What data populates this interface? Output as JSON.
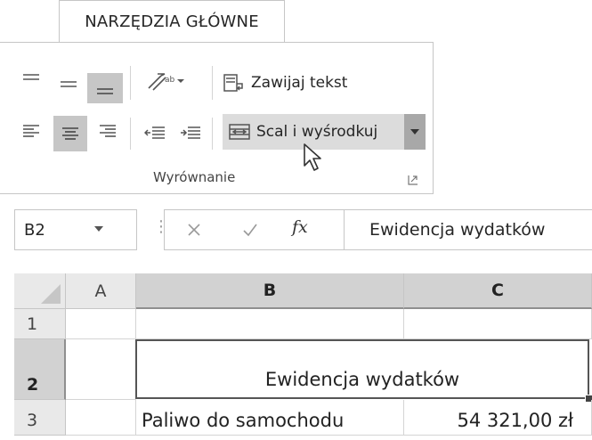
{
  "ribbon": {
    "tab_label": "NARZĘDZIA GŁÓWNE",
    "wrap_text_label": "Zawijaj tekst",
    "merge_center_label": "Scal i wyśrodkuj",
    "group_label": "Wyrównanie"
  },
  "formula_bar": {
    "name_box": "B2",
    "content": "Ewidencja wydatków",
    "fx_label": "fx"
  },
  "grid": {
    "columns": [
      "A",
      "B",
      "C"
    ],
    "rows": [
      "1",
      "2",
      "3"
    ],
    "merged_b2_c2": "Ewidencja wydatków",
    "b3": "Paliwo do samochodu",
    "c3": "54 321,00 zł"
  }
}
